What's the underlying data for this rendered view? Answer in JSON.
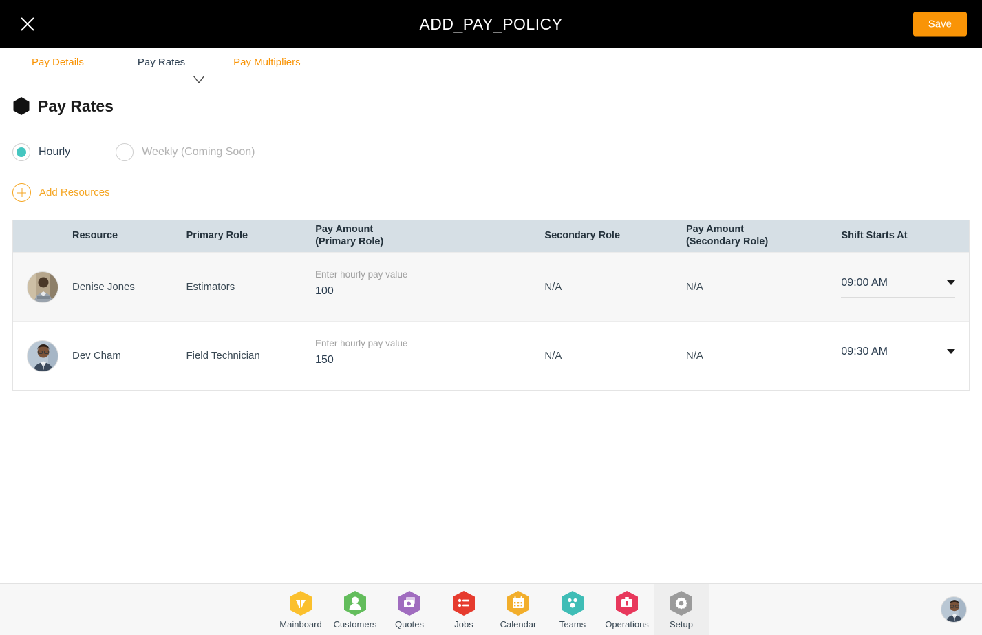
{
  "header": {
    "title": "ADD_PAY_POLICY",
    "close_icon": "close-icon",
    "save_label": "Save",
    "save_color": "#f99406"
  },
  "tabs": [
    {
      "label": "Pay Details",
      "active": false
    },
    {
      "label": "Pay Rates",
      "active": true
    },
    {
      "label": "Pay Multipliers",
      "active": false
    }
  ],
  "section": {
    "title": "Pay Rates",
    "marker_icon": "hexagon-icon",
    "marker_color": "#111111"
  },
  "pay_type": {
    "selected": "Hourly",
    "accent_color": "#45c6c0",
    "options": [
      {
        "label": "Hourly",
        "selected": true,
        "disabled": false
      },
      {
        "label": "Weekly (Coming Soon)",
        "selected": false,
        "disabled": true
      }
    ]
  },
  "add_resources": {
    "label": "Add Resources",
    "icon": "plus-circle-icon",
    "color": "#f5a623"
  },
  "table": {
    "header_bg": "#d6dfe5",
    "columns": [
      "Resource",
      "Primary Role",
      "Pay Amount\n(Primary Role)",
      "Secondary Role",
      "Pay Amount\n(Secondary Role)",
      "Shift Starts At"
    ],
    "columns_split": [
      {
        "line1": "Resource",
        "line2": ""
      },
      {
        "line1": "Primary Role",
        "line2": ""
      },
      {
        "line1": "Pay Amount",
        "line2": "(Primary Role)"
      },
      {
        "line1": "Secondary Role",
        "line2": ""
      },
      {
        "line1": "Pay Amount",
        "line2": "(Secondary Role)"
      },
      {
        "line1": "Shift Starts At",
        "line2": ""
      }
    ],
    "rows": [
      {
        "resource": "Denise Jones",
        "avatar": "avatar-denise-jones",
        "primary_role": "Estimators",
        "pay_primary_placeholder": "Enter hourly pay value",
        "pay_primary_value": "100",
        "secondary_role": "N/A",
        "pay_secondary": "N/A",
        "shift_starts_at": "09:00 AM"
      },
      {
        "resource": "Dev Cham",
        "avatar": "avatar-dev-cham",
        "primary_role": "Field Technician",
        "pay_primary_placeholder": "Enter hourly pay value",
        "pay_primary_value": "150",
        "secondary_role": "N/A",
        "pay_secondary": "N/A",
        "shift_starts_at": "09:30 AM"
      }
    ]
  },
  "bottom_nav": {
    "active": "Setup",
    "items": [
      {
        "label": "Mainboard",
        "icon": "mainboard-icon",
        "color": "#fbc02d"
      },
      {
        "label": "Customers",
        "icon": "customers-icon",
        "color": "#63bd5c"
      },
      {
        "label": "Quotes",
        "icon": "quotes-icon",
        "color": "#a06cbf"
      },
      {
        "label": "Jobs",
        "icon": "jobs-icon",
        "color": "#e63b2e"
      },
      {
        "label": "Calendar",
        "icon": "calendar-icon",
        "color": "#f2ae2b"
      },
      {
        "label": "Teams",
        "icon": "teams-icon",
        "color": "#3fbdb6"
      },
      {
        "label": "Operations",
        "icon": "operations-icon",
        "color": "#e8385c"
      },
      {
        "label": "Setup",
        "icon": "gear-icon",
        "color": "#9b9b9b"
      }
    ],
    "user_avatar": "user-avatar"
  }
}
